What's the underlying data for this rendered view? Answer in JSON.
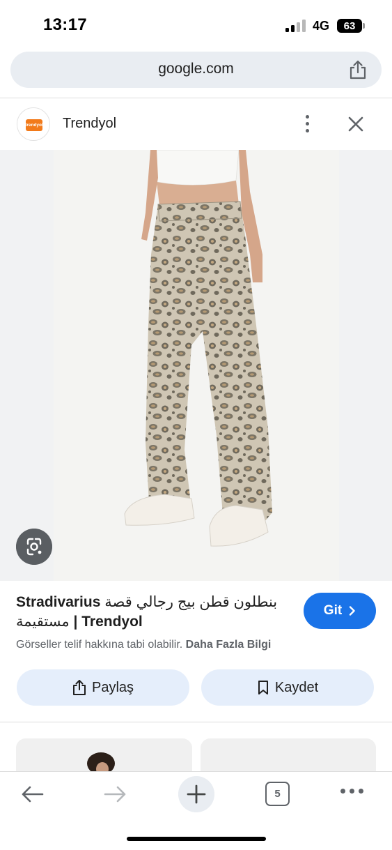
{
  "status_bar": {
    "time": "13:17",
    "network": "4G",
    "battery": "63"
  },
  "browser": {
    "url": "google.com",
    "tab_count": "5"
  },
  "source": {
    "logo_text": "trendyol",
    "name": "Trendyol"
  },
  "result": {
    "title_brand": "Stradivarius ",
    "title_arabic": "بنطلون قطن بيج رجالي قصة مستقيمة",
    "title_suffix": " | Trendyol",
    "visit_label": "Git",
    "copyright_text": "Görseller telif hakkına tabi olabilir. ",
    "more_info_link": "Daha Fazla Bilgi",
    "share_label": "Paylaş",
    "save_label": "Kaydet"
  },
  "colors": {
    "accent": "#1a73e8",
    "brand": "#f27a1a",
    "action_bg": "#e5eefb"
  },
  "icons": {
    "url_share": "share-icon",
    "more": "more-vert-icon",
    "close": "close-icon",
    "lens": "google-lens-icon",
    "visit_chevron": "chevron-right-icon",
    "share": "share-icon",
    "save": "bookmark-icon",
    "back": "arrow-back-icon",
    "forward": "arrow-forward-icon",
    "new_tab": "plus-icon",
    "tabs": "tab-switcher-icon",
    "menu": "more-horiz-icon"
  }
}
